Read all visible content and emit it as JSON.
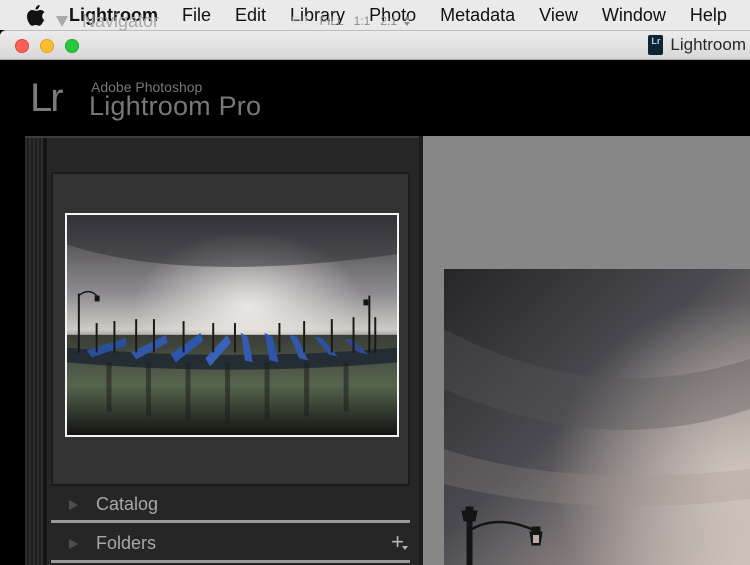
{
  "menubar": {
    "apple_icon": "apple-icon",
    "items": [
      "Lightroom",
      "File",
      "Edit",
      "Library",
      "Photo",
      "Metadata",
      "View",
      "Window",
      "Help"
    ]
  },
  "window": {
    "title": "Lightroom",
    "doc_icon_text": "Lr"
  },
  "identity_plate": {
    "mark": "Lr",
    "line1": "Adobe Photoshop",
    "line2": "Lightroom Pro"
  },
  "navigator": {
    "title": "Navigator",
    "zoom_options": [
      "FIT",
      "FILL",
      "1:1",
      "2:1"
    ],
    "active_zoom": "FIT"
  },
  "panels": {
    "catalog": "Catalog",
    "folders": "Folders",
    "add_icon": "plus-icon"
  },
  "colors": {
    "panel_bg": "#262626",
    "canvas_bg": "#878787",
    "menubar_bg": "#eaeaea"
  }
}
